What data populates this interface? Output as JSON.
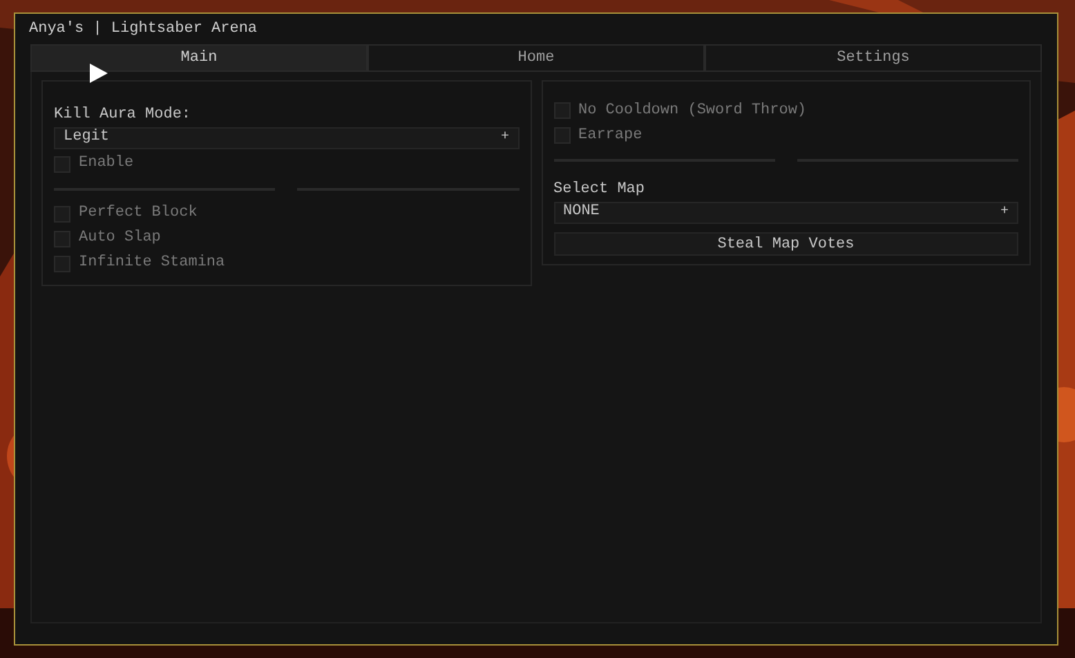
{
  "window": {
    "title": "Anya's | Lightsaber Arena"
  },
  "tabs": [
    {
      "label": "Main",
      "selected": true
    },
    {
      "label": "Home",
      "selected": false
    },
    {
      "label": "Settings",
      "selected": false
    }
  ],
  "panels": [
    {
      "items": [
        {
          "kind": "label",
          "text": "Kill Aura Mode:"
        },
        {
          "kind": "dropdown",
          "value": "Legit",
          "expander": "+"
        },
        {
          "kind": "checkbox",
          "label": "Enable",
          "checked": false
        },
        {
          "kind": "separator"
        },
        {
          "kind": "checkbox",
          "label": "Perfect Block",
          "checked": false
        },
        {
          "kind": "checkbox",
          "label": "Auto Slap",
          "checked": false
        },
        {
          "kind": "checkbox",
          "label": "Infinite Stamina",
          "checked": false
        }
      ]
    },
    {
      "items": [
        {
          "kind": "checkbox",
          "label": "No Cooldown (Sword Throw)",
          "checked": false
        },
        {
          "kind": "checkbox",
          "label": "Earrape",
          "checked": false
        },
        {
          "kind": "separator"
        },
        {
          "kind": "label",
          "text": "Select Map"
        },
        {
          "kind": "dropdown",
          "value": "NONE",
          "expander": "+"
        },
        {
          "kind": "button",
          "label": "Steal Map Votes"
        }
      ]
    }
  ]
}
